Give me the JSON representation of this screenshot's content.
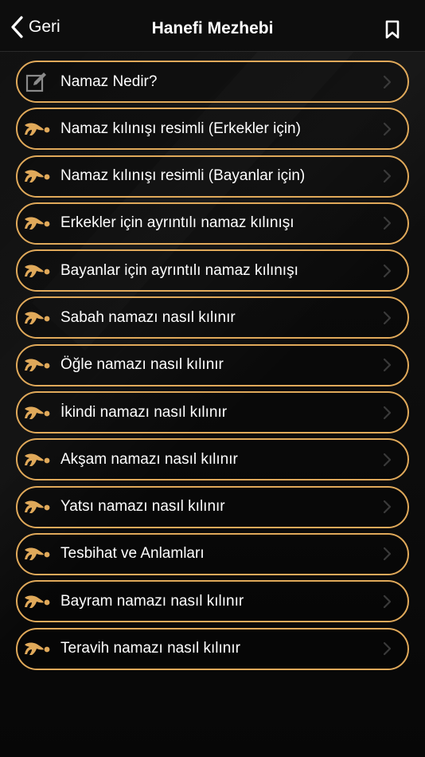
{
  "nav": {
    "back_label": "Geri",
    "title": "Hanefi Mezhebi",
    "back_icon": "chevron-left-icon",
    "bookmark_icon": "bookmark-icon"
  },
  "colors": {
    "accent": "#e0a95a",
    "background": "#0b0b0b",
    "text": "#ffffff"
  },
  "items": [
    {
      "label": "Namaz Nedir?",
      "icon": "edit-icon"
    },
    {
      "label": "Namaz kılınışı resimli (Erkekler için)",
      "icon": "prayer-icon"
    },
    {
      "label": "Namaz kılınışı resimli (Bayanlar için)",
      "icon": "prayer-icon"
    },
    {
      "label": "Erkekler için ayrıntılı namaz kılınışı",
      "icon": "prayer-icon"
    },
    {
      "label": "Bayanlar için ayrıntılı namaz kılınışı",
      "icon": "prayer-icon"
    },
    {
      "label": "Sabah namazı nasıl kılınır",
      "icon": "prayer-icon"
    },
    {
      "label": "Öğle namazı nasıl kılınır",
      "icon": "prayer-icon"
    },
    {
      "label": "İkindi namazı nasıl kılınır",
      "icon": "prayer-icon"
    },
    {
      "label": "Akşam namazı nasıl kılınır",
      "icon": "prayer-icon"
    },
    {
      "label": "Yatsı namazı nasıl kılınır",
      "icon": "prayer-icon"
    },
    {
      "label": "Tesbihat ve Anlamları",
      "icon": "prayer-icon"
    },
    {
      "label": "Bayram namazı nasıl kılınır",
      "icon": "prayer-icon"
    },
    {
      "label": "Teravih namazı nasıl kılınır",
      "icon": "prayer-icon"
    }
  ]
}
